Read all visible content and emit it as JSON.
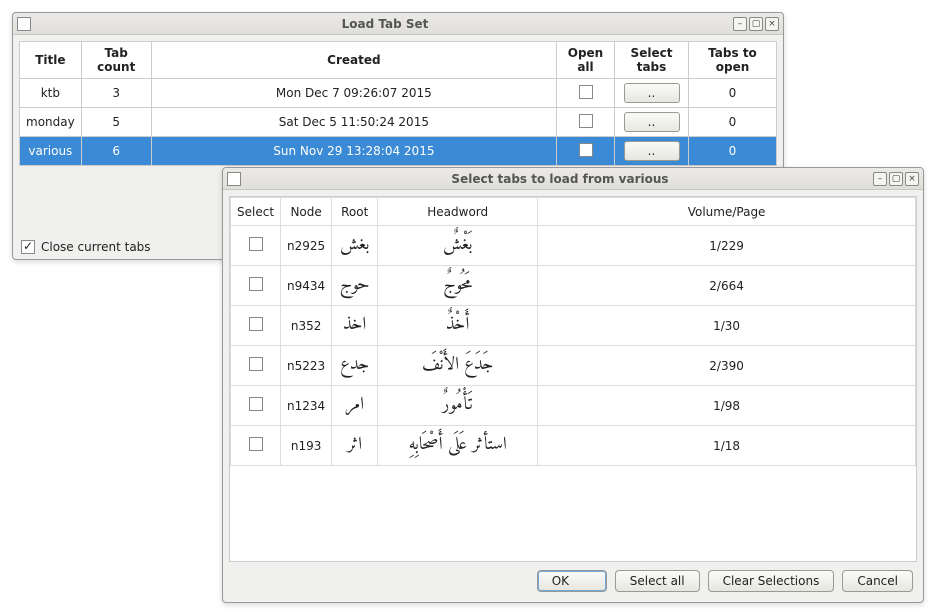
{
  "main_window": {
    "title": "Load Tab Set",
    "headers": {
      "title": "Title",
      "tab_count": "Tab count",
      "created": "Created",
      "open_all": "Open all",
      "select_tabs": "Select tabs",
      "tabs_to_open": "Tabs to open"
    },
    "rows": [
      {
        "title": "ktb",
        "tab_count": "3",
        "created": "Mon Dec 7 09:26:07 2015",
        "btn": "..",
        "tabs_to_open": "0"
      },
      {
        "title": "monday",
        "tab_count": "5",
        "created": "Sat Dec 5 11:50:24 2015",
        "btn": "..",
        "tabs_to_open": "0"
      },
      {
        "title": "various",
        "tab_count": "6",
        "created": "Sun Nov 29 13:28:04 2015",
        "btn": "..",
        "tabs_to_open": "0"
      }
    ],
    "close_tabs_label": "Close current tabs"
  },
  "sub_window": {
    "title": "Select tabs to load from various",
    "headers": {
      "select": "Select",
      "node": "Node",
      "root": "Root",
      "headword": "Headword",
      "volpage": "Volume/Page"
    },
    "rows": [
      {
        "node": "n2925",
        "root": "بغش",
        "headword": "بَغْشٌ",
        "volpage": "1/229"
      },
      {
        "node": "n9434",
        "root": "حوج",
        "headword": "مَحُوجٌ",
        "volpage": "2/664"
      },
      {
        "node": "n352",
        "root": "اخذ",
        "headword": "أَخْذٌ",
        "volpage": "1/30"
      },
      {
        "node": "n5223",
        "root": "جدع",
        "headword": "جَدَعَ الأَنْفَ",
        "volpage": "2/390"
      },
      {
        "node": "n1234",
        "root": "امر",
        "headword": "تَأْمُورٌ",
        "volpage": "1/98"
      },
      {
        "node": "n193",
        "root": "اثر",
        "headword": "استأثر عَلَى أَصْحَابِهِ",
        "volpage": "1/18"
      }
    ],
    "buttons": {
      "ok": "OK",
      "select_all": "Select all",
      "clear": "Clear Selections",
      "cancel": "Cancel"
    }
  }
}
